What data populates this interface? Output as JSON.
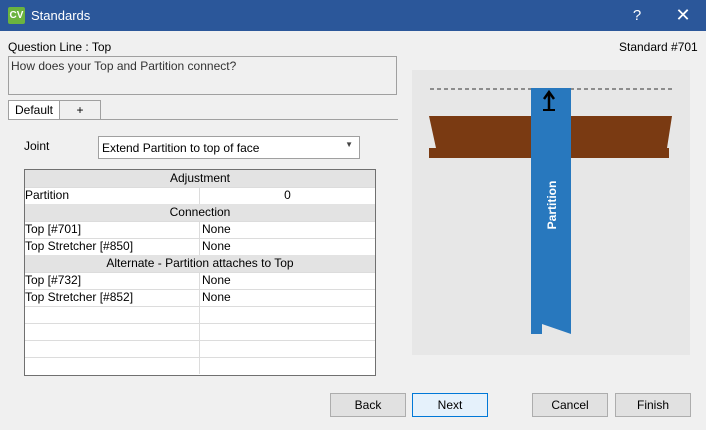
{
  "window": {
    "title": "Standards",
    "app_icon": "CV",
    "help": "?",
    "close": "✕"
  },
  "header": {
    "question_line": "Question Line : Top",
    "standard": "Standard #701"
  },
  "question": {
    "text": "How does your Top and Partition connect?"
  },
  "tabs": [
    {
      "label": "Default",
      "active": true
    },
    {
      "label": "+"
    }
  ],
  "joint": {
    "label": "Joint",
    "selected": "Extend Partition to top of face"
  },
  "grid": {
    "sec1": "Adjustment",
    "r1": {
      "name": "Partition",
      "value": "0"
    },
    "sec2": "Connection",
    "r2": {
      "name": "Top [#701]",
      "value": "None"
    },
    "r3": {
      "name": "Top Stretcher [#850]",
      "value": "None"
    },
    "sec3": "Alternate - Partition attaches to Top",
    "r4": {
      "name": "Top [#732]",
      "value": "None"
    },
    "r5": {
      "name": "Top Stretcher [#852]",
      "value": "None"
    }
  },
  "preview": {
    "partition_label": "Partition",
    "colors": {
      "wood": "#7a3a12",
      "partition": "#2878be",
      "background": "#e7e7e7"
    }
  },
  "buttons": {
    "back": "Back",
    "next": "Next",
    "cancel": "Cancel",
    "finish": "Finish"
  }
}
